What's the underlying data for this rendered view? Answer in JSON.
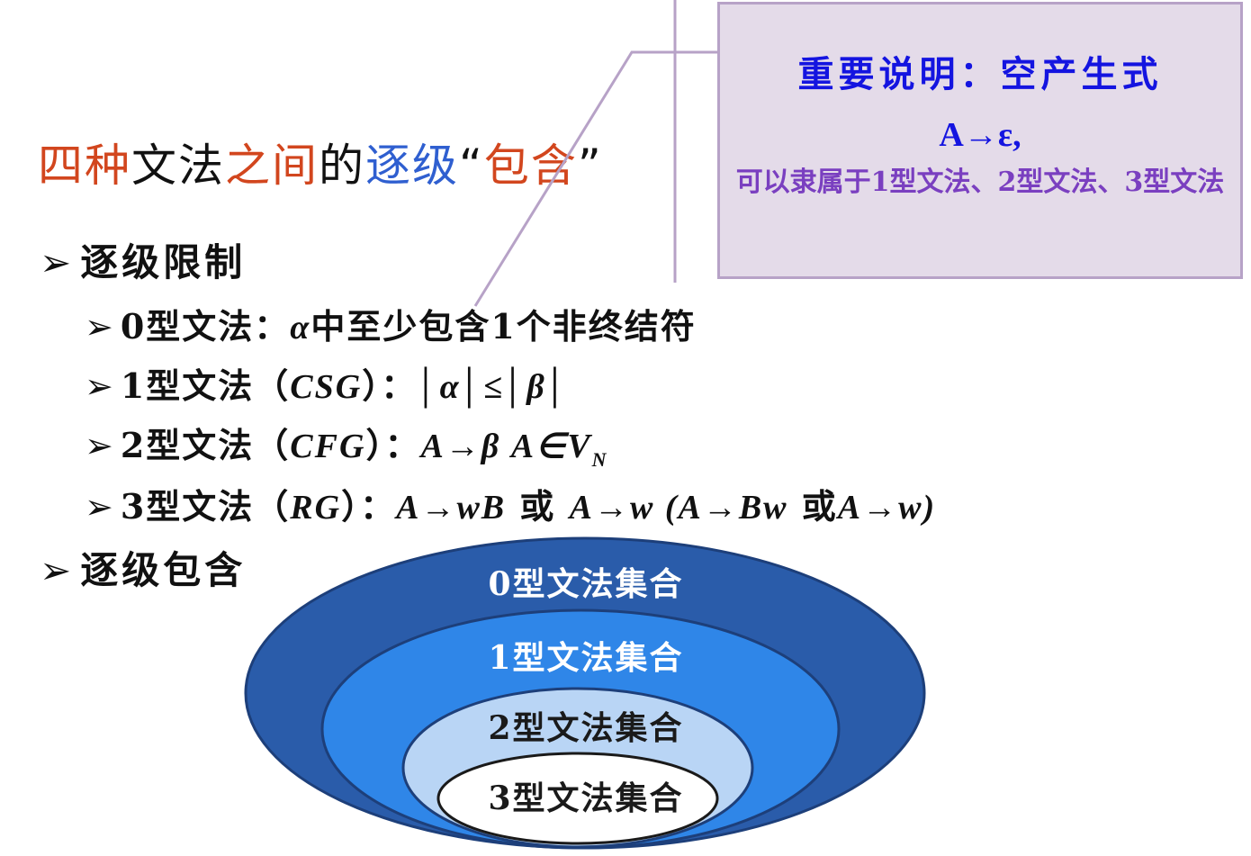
{
  "title": {
    "segments": [
      {
        "text": "四种",
        "color": "#d2461e"
      },
      {
        "text": "文法",
        "color": "#111111"
      },
      {
        "text": "之间",
        "color": "#d2461e"
      },
      {
        "text": "的",
        "color": "#111111"
      },
      {
        "text": "逐级",
        "color": "#2f5fd0"
      },
      {
        "text": "“",
        "color": "#111111"
      },
      {
        "text": "包含",
        "color": "#d2461e"
      },
      {
        "text": "”",
        "color": "#111111"
      }
    ]
  },
  "callout": {
    "heading": "重要说明：空产生式",
    "formula": "A→ε,",
    "note": "可以隶属于1型文法、2型文法、3型文法"
  },
  "bullets": {
    "level_restriction": "逐级限制",
    "type0": {
      "label": "0型文法：",
      "math": "α",
      "rest": "中至少包含1个非终结符"
    },
    "type1": {
      "label": "1型文法（",
      "abbr": "CSG",
      "close": "）：",
      "math": "│α│≤│β│"
    },
    "type2": {
      "label": "2型文法（",
      "abbr": "CFG",
      "close": "）：",
      "math": "A→β  A∈V",
      "math_sub": "N"
    },
    "type3": {
      "label": "3型文法（",
      "abbr": "RG",
      "close": "）：",
      "rule_a": "A→wB",
      "or1": " 或 ",
      "rule_b": "A→w",
      "paren_open": "  (",
      "rule_c": "A→Bw",
      "or2": " 或",
      "rule_d": "A→w",
      "paren_close": ")"
    },
    "level_inclusion": "逐级包含"
  },
  "diagram": {
    "sets": [
      {
        "label": "0型文法集合",
        "color": "#2a5caa"
      },
      {
        "label": "1型文法集合",
        "color": "#2f86e8"
      },
      {
        "label": "2型文法集合",
        "color": "#b9d5f5"
      },
      {
        "label": "3型文法集合",
        "color": "#ffffff"
      }
    ]
  },
  "bullet_glyph": "➢"
}
